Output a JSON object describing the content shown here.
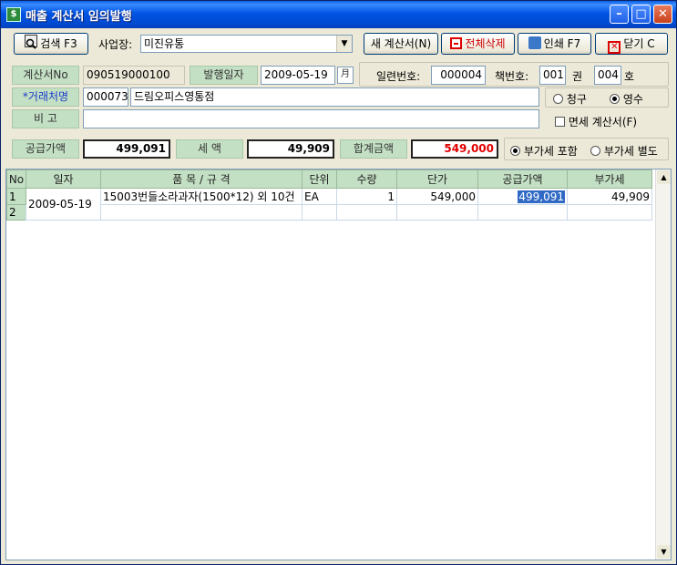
{
  "window": {
    "title": "매출 계산서 임의발행",
    "icon_text": "$"
  },
  "toolbar": {
    "search_label": "검색 F3",
    "site_label": "사업장:",
    "site_value": "미진유통",
    "new_label": "새 계산서(N)",
    "delete_all_label": "전체삭제",
    "print_label": "인쇄 F7",
    "close_label": "닫기 C"
  },
  "header": {
    "invoice_no_label": "계산서No",
    "invoice_no": "090519000100",
    "issue_date_label": "발행일자",
    "issue_date": "2009-05-19",
    "calendar_text": "月",
    "serial_label": "일련번호:",
    "serial_no": "000004",
    "book_label": "책번호:",
    "book_no": "001",
    "volume_label": "권",
    "ho_no": "004",
    "ho_label": "호",
    "client_label": "*거래처명",
    "client_code": "000073",
    "client_name": "드림오피스영통점",
    "memo_label": "비    고",
    "memo_value": "",
    "claim_label": "청구",
    "receipt_label": "영수",
    "taxfree_label": "면세 계산서(F)"
  },
  "totals": {
    "supply_label": "공급가액",
    "supply_value": "499,091",
    "tax_label": "세    액",
    "tax_value": "49,909",
    "total_label": "합계금액",
    "total_value": "549,000",
    "vat_include_label": "부가세 포함",
    "vat_separate_label": "부가세 별도"
  },
  "colors": {
    "total_red": "#e00000",
    "grid_header": "#c4e0c4",
    "label_blue": "#1a3cc8"
  },
  "table": {
    "headers": [
      "No",
      "일자",
      "품 목 / 규 격",
      "단위",
      "수량",
      "단가",
      "공급가액",
      "부가세"
    ],
    "rows": [
      {
        "no": "1",
        "date": "2009-05-19",
        "item": "15003번들소라과자(1500*12) 외 10건",
        "unit": "EA",
        "qty": "1",
        "price": "549,000",
        "supply": "499,091",
        "vat": "49,909"
      },
      {
        "no": "2",
        "date": "",
        "item": "",
        "unit": "",
        "qty": "",
        "price": "",
        "supply": "",
        "vat": ""
      }
    ]
  }
}
